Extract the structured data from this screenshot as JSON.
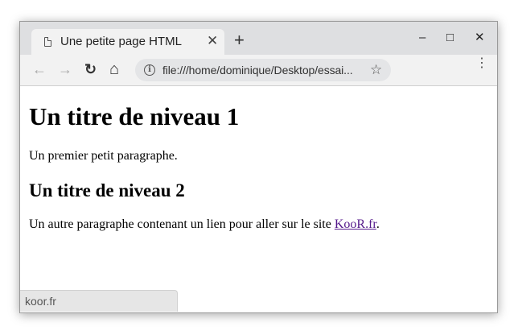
{
  "tab": {
    "title": "Une petite page HTML",
    "close_glyph": "✕",
    "new_tab_glyph": "+"
  },
  "window_controls": {
    "minimize_glyph": "–",
    "maximize_glyph": "□",
    "close_glyph": "✕"
  },
  "toolbar": {
    "back_glyph": "←",
    "forward_glyph": "→",
    "reload_glyph": "↻",
    "home_glyph": "⌂",
    "url": "file:///home/dominique/Desktop/essai...",
    "info_glyph": "i",
    "star_glyph": "☆",
    "menu_glyph": "⋮"
  },
  "page": {
    "heading1": "Un titre de niveau 1",
    "paragraph1": "Un premier petit paragraphe.",
    "heading2": "Un titre de niveau 2",
    "paragraph2_before": "Un autre paragraphe contenant un lien pour aller sur le site ",
    "link_text": "KooR.fr",
    "paragraph2_after": "."
  },
  "status": {
    "hover_url": "koor.fr"
  },
  "colors": {
    "tabstrip_bg": "#dedfe1",
    "toolbar_bg": "#f2f2f2",
    "omnibox_bg": "#e4e5e7",
    "visited_link": "#551a8b"
  }
}
